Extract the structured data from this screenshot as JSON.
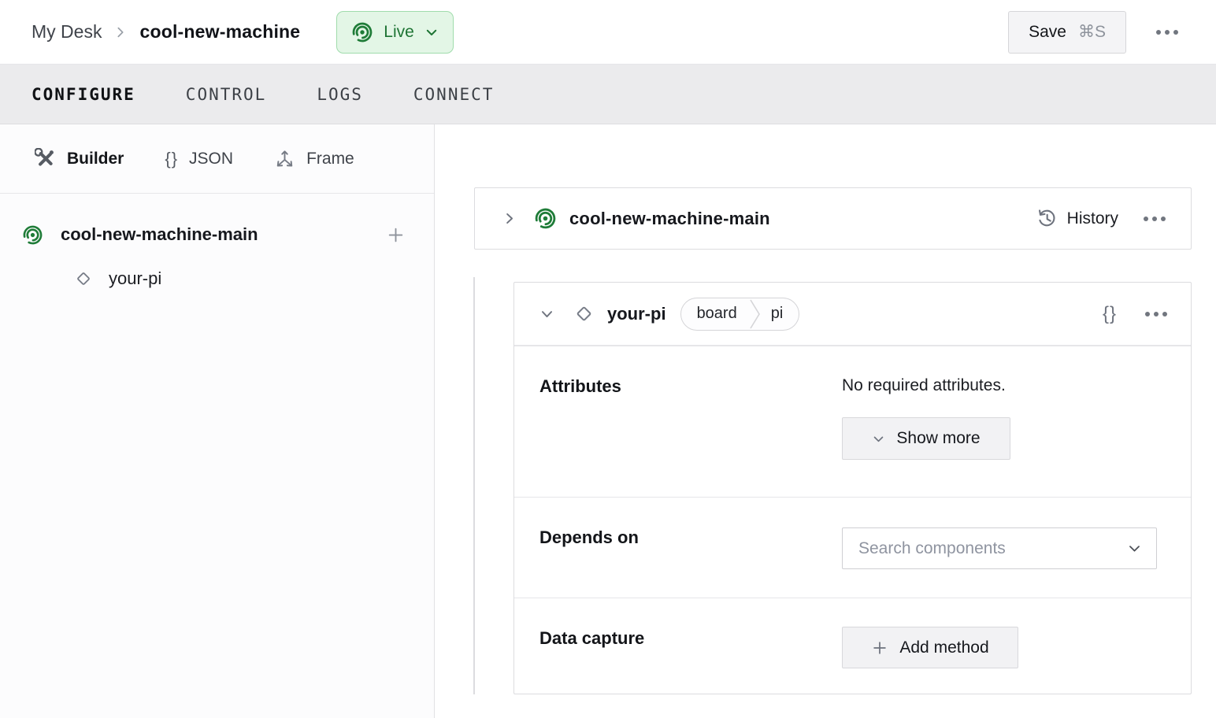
{
  "header": {
    "breadcrumb": {
      "parent": "My Desk",
      "current": "cool-new-machine"
    },
    "status": {
      "label": "Live"
    },
    "save": {
      "label": "Save",
      "shortcut": "⌘S"
    }
  },
  "tabs": [
    {
      "label": "CONFIGURE",
      "active": true
    },
    {
      "label": "CONTROL",
      "active": false
    },
    {
      "label": "LOGS",
      "active": false
    },
    {
      "label": "CONNECT",
      "active": false
    }
  ],
  "sidebar": {
    "modes": [
      {
        "label": "Builder",
        "icon": "tools-icon",
        "active": true
      },
      {
        "label": "JSON",
        "icon": "braces-icon",
        "active": false
      },
      {
        "label": "Frame",
        "icon": "axes-icon",
        "active": false
      }
    ],
    "tree": {
      "machine": {
        "label": "cool-new-machine-main",
        "icon": "machine-live-icon"
      },
      "component": {
        "label": "your-pi",
        "icon": "component-diamond-icon"
      }
    }
  },
  "main": {
    "machine_card": {
      "title": "cool-new-machine-main",
      "history_label": "History"
    },
    "component_card": {
      "title": "your-pi",
      "badge": {
        "type": "board",
        "model": "pi"
      },
      "attributes": {
        "label": "Attributes",
        "empty_text": "No required attributes.",
        "show_more_label": "Show more"
      },
      "depends_on": {
        "label": "Depends on",
        "search_placeholder": "Search components"
      },
      "data_capture": {
        "label": "Data capture",
        "add_method_label": "Add method"
      }
    }
  },
  "icons": {
    "braces": "{}"
  },
  "colors": {
    "accent_green": "#1f7c38",
    "live_badge_bg": "#e3f6e6",
    "live_badge_border": "#a0dcac",
    "tabbar_bg": "#ebebed",
    "card_border": "#dcdcdf",
    "button_bg": "#f2f2f4"
  }
}
